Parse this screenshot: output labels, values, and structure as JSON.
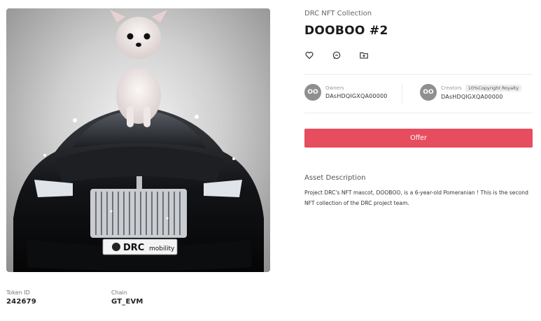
{
  "artwork": {
    "plate_text": "DRC mobility",
    "plate_text_main": "DRC",
    "plate_text_sub": "mobility"
  },
  "token": {
    "label": "Token ID",
    "value": "242679"
  },
  "chain": {
    "label": "Chain",
    "value": "GT_EVM"
  },
  "collection_name": "DRC NFT Collection",
  "nft_title": "DOOBOO #2",
  "actions": [
    "heart-icon",
    "chat-icon",
    "folder-plus-icon"
  ],
  "owners": {
    "label": "Owners",
    "avatar_text": "OO",
    "value": "DAsHDQIGXQA00000"
  },
  "creators": {
    "label": "Creators",
    "royalty": "10%Copyright Royalty",
    "avatar_text": "OO",
    "value": "DAsHDQIGXQA00000"
  },
  "offer_label": "Offer",
  "description": {
    "title": "Asset Description",
    "text": "Project DRC's NFT mascot, DOOBOO, is a 6-year-old Pomeranian ! This is the second NFT collection of the DRC project team."
  },
  "colors": {
    "offer": "#e64d5f",
    "avatar": "#8f8f8f"
  }
}
